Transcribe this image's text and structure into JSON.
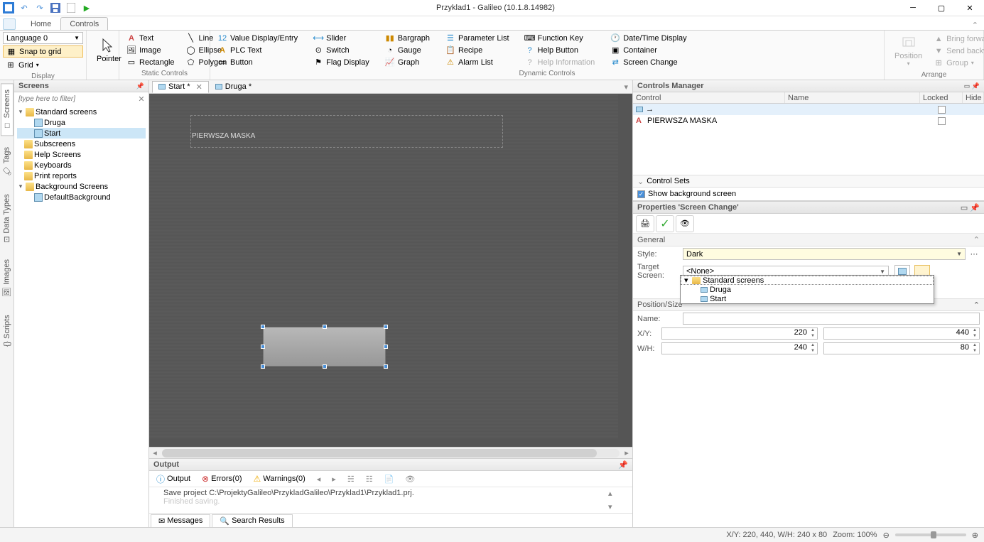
{
  "app": {
    "title": "Przyklad1 - Galileo (10.1.8.14982)"
  },
  "tabs": {
    "home": "Home",
    "controls": "Controls"
  },
  "ribbon": {
    "display": {
      "title": "Display",
      "language": "Language 0",
      "snap": "Snap to grid",
      "grid": "Grid"
    },
    "pointer": "Pointer",
    "static": {
      "title": "Static Controls",
      "text": "Text",
      "image": "Image",
      "rectangle": "Rectangle",
      "line": "Line",
      "ellipse": "Ellipse",
      "polygon": "Polygon"
    },
    "dynamic": {
      "title": "Dynamic Controls",
      "valueDisplay": "Value Display/Entry",
      "plcText": "PLC Text",
      "button": "Button",
      "slider": "Slider",
      "switch": "Switch",
      "flagDisplay": "Flag Display",
      "bargraph": "Bargraph",
      "gauge": "Gauge",
      "graph": "Graph",
      "paramList": "Parameter List",
      "recipe": "Recipe",
      "alarmList": "Alarm List",
      "functionKey": "Function Key",
      "helpButton": "Help Button",
      "helpInfo": "Help Information",
      "dateTime": "Date/Time Display",
      "container": "Container",
      "screenChange": "Screen Change"
    },
    "arrange": {
      "title": "Arrange",
      "position": "Position",
      "bringForward": "Bring forward",
      "sendBackward": "Send backward",
      "group": "Group"
    }
  },
  "screens": {
    "title": "Screens",
    "filter": "[type here to filter]",
    "tree": {
      "standard": "Standard screens",
      "druga": "Druga",
      "start": "Start",
      "subscreens": "Subscreens",
      "helpScreens": "Help Screens",
      "keyboards": "Keyboards",
      "printReports": "Print reports",
      "bgScreens": "Background Screens",
      "defaultBg": "DefaultBackground"
    }
  },
  "leftTabs": {
    "screens": "Screens",
    "tags": "Tags",
    "dataTypes": "Data Types",
    "images": "Images",
    "scripts": "Scripts"
  },
  "docTabs": {
    "start": "Start *",
    "druga": "Druga *"
  },
  "canvas": {
    "maskText": "PIERWSZA MASKA"
  },
  "output": {
    "title": "Output",
    "outputBtn": "Output",
    "errors": "Errors(0)",
    "warnings": "Warnings(0)",
    "message": "Save project C:\\ProjektyGalileo\\PrzykladGalileo\\Przyklad1\\Przyklad1.prj.",
    "message2": "Finished saving.",
    "msgTab": "Messages",
    "searchTab": "Search Results"
  },
  "ctrlMgr": {
    "title": "Controls Manager",
    "cols": {
      "control": "Control",
      "name": "Name",
      "locked": "Locked",
      "hide": "Hide"
    },
    "row1": "→",
    "row2": "PIERWSZA MASKA",
    "sets": "Control Sets",
    "bgScreen": "Show background screen"
  },
  "props": {
    "title": "Properties 'Screen Change'",
    "general": "General",
    "style": "Style:",
    "styleVal": "Dark",
    "target": "Target Screen:",
    "targetVal": "<None>",
    "dd": {
      "std": "Standard screens",
      "druga": "Druga",
      "start": "Start"
    },
    "posSize": "Position/Size",
    "name": "Name:",
    "xy": "X/Y:",
    "wh": "W/H:",
    "x": "220",
    "y": "440",
    "w": "240",
    "h": "80"
  },
  "status": {
    "coords": "X/Y: 220, 440, W/H: 240 x 80",
    "zoom": "Zoom: 100%"
  }
}
